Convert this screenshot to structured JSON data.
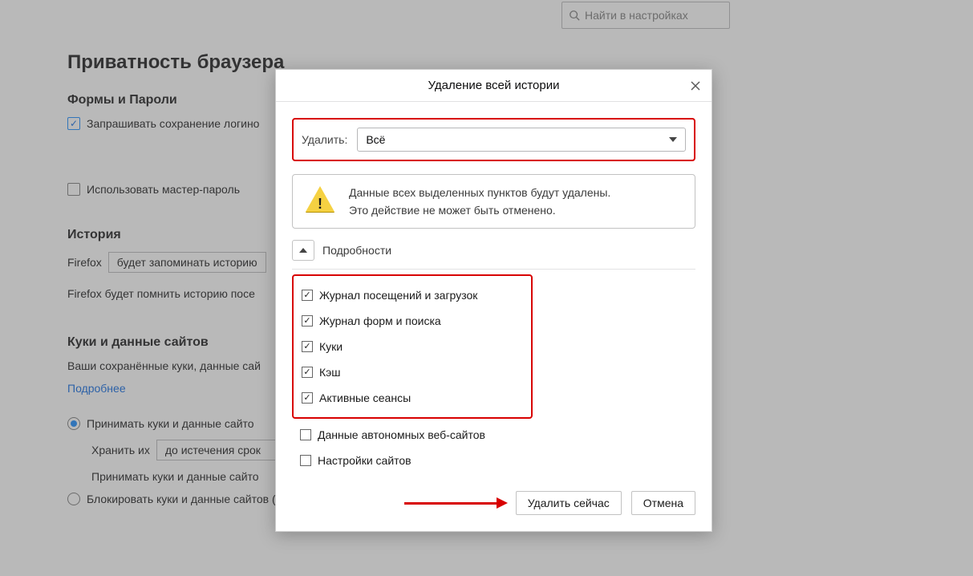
{
  "search": {
    "placeholder": "Найти в настройках"
  },
  "bg": {
    "privacy_heading": "Приватность браузера",
    "forms_heading": "Формы и Пароли",
    "ask_save_logins": "Запрашивать сохранение логино",
    "use_master_password": "Использовать мастер-пароль",
    "history_heading": "История",
    "firefox_label": "Firefox",
    "history_mode": "будет запоминать историю",
    "history_desc": "Firefox будет помнить историю посе",
    "cookies_heading": "Куки и данные сайтов",
    "cookies_desc": "Ваши сохранённые куки, данные сай",
    "learn_more": "Подробнее",
    "accept_cookies": "Принимать куки и данные сайто",
    "keep_label": "Хранить их",
    "keep_value": "до истечения срок",
    "accept_third_party": "Принимать куки и данные сайто",
    "block_cookies": "Блокировать куки и данные сайтов (может нарушить работу веб-сайтов)"
  },
  "modal": {
    "title": "Удаление всей истории",
    "delete_label": "Удалить:",
    "range_value": "Всё",
    "warn_line1": "Данные всех выделенных пунктов будут удалены.",
    "warn_line2": "Это действие не может быть отменено.",
    "details_label": "Подробности",
    "items": {
      "visits": "Журнал посещений и загрузок",
      "forms": "Журнал форм и поиска",
      "cookies": "Куки",
      "cache": "Кэш",
      "sessions": "Активные сеансы",
      "offline": "Данные автономных веб-сайтов",
      "site_settings": "Настройки сайтов"
    },
    "delete_now": "Удалить сейчас",
    "cancel": "Отмена"
  }
}
